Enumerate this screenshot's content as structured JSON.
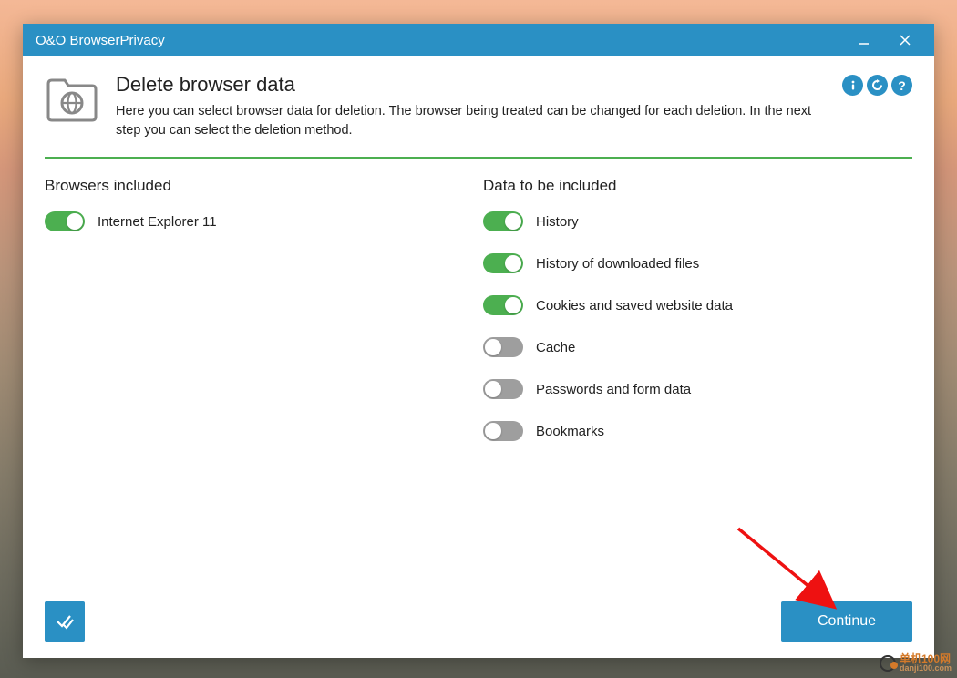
{
  "window": {
    "title": "O&O BrowserPrivacy"
  },
  "header": {
    "title": "Delete browser data",
    "description": "Here you can select browser data for deletion. The browser being treated can be changed for each deletion. In the next step you can select the deletion method."
  },
  "browsers": {
    "title": "Browsers included",
    "items": [
      {
        "label": "Internet Explorer 11",
        "on": true
      }
    ]
  },
  "data": {
    "title": "Data to be included",
    "items": [
      {
        "label": "History",
        "on": true
      },
      {
        "label": "History of downloaded files",
        "on": true
      },
      {
        "label": "Cookies and saved website data",
        "on": true
      },
      {
        "label": "Cache",
        "on": false
      },
      {
        "label": "Passwords and form data",
        "on": false
      },
      {
        "label": "Bookmarks",
        "on": false
      }
    ]
  },
  "footer": {
    "continue": "Continue"
  },
  "watermark": {
    "text": "单机100网",
    "sub": "danji100.com"
  }
}
